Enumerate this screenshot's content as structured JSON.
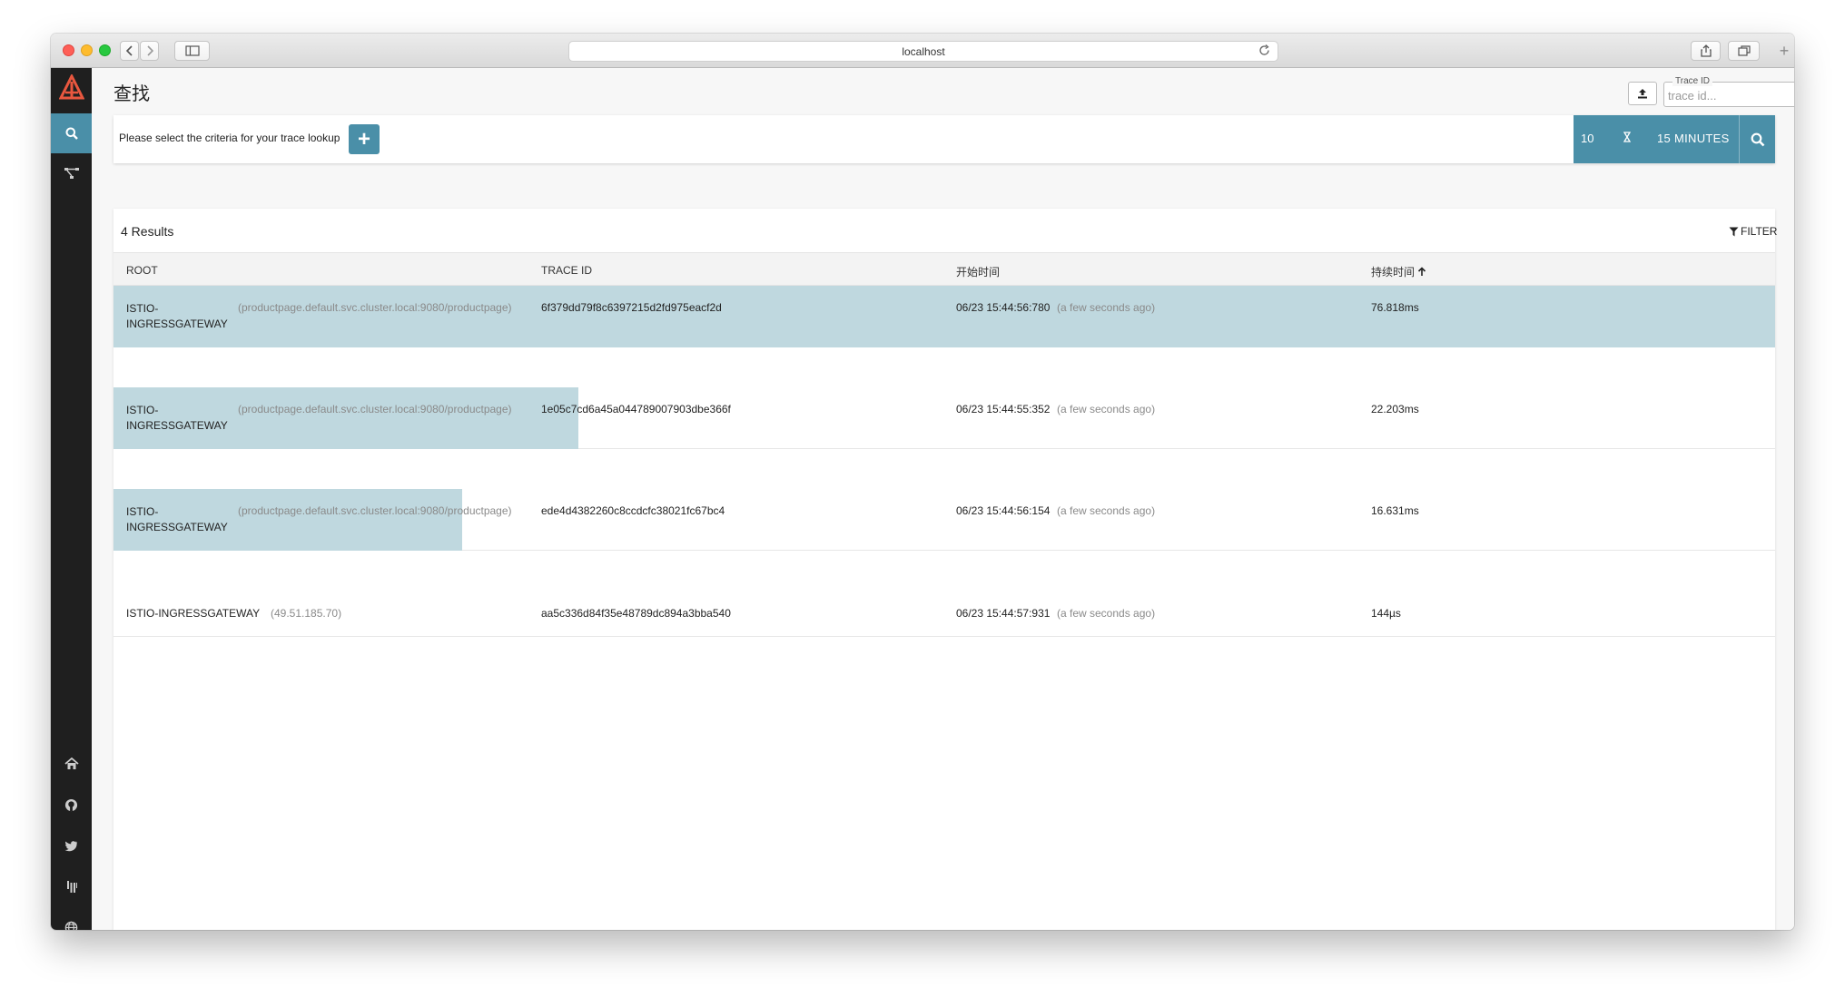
{
  "browser": {
    "url": "localhost"
  },
  "page": {
    "title": "查找"
  },
  "traceid": {
    "label": "Trace ID",
    "placeholder": "trace id..."
  },
  "criteria": {
    "prompt": "Please select the criteria for your trace lookup",
    "add": "+",
    "limit": "10",
    "lookback": "15 MINUTES"
  },
  "results": {
    "count": "4 Results",
    "filter": "FILTER",
    "columns": {
      "root": "ROOT",
      "trace_id": "TRACE ID",
      "start": "开始时间",
      "duration": "持续时间"
    },
    "rows": [
      {
        "root": "ISTIO-INGRESSGATEWAY",
        "detail": "(productpage.default.svc.cluster.local:9080/productpage)",
        "trace_id": "6f379dd79f8c6397215d2fd975eacf2d",
        "start": "06/23 15:44:56:780",
        "ago": "(a few seconds ago)",
        "duration": "76.818ms",
        "duration_fraction": 1.0
      },
      {
        "root": "ISTIO-INGRESSGATEWAY",
        "detail": "(productpage.default.svc.cluster.local:9080/productpage)",
        "trace_id": "1e05c7cd6a45a044789007903dbe366f",
        "start": "06/23 15:44:55:352",
        "ago": "(a few seconds ago)",
        "duration": "22.203ms",
        "duration_fraction": 0.28
      },
      {
        "root": "ISTIO-INGRESSGATEWAY",
        "detail": "(productpage.default.svc.cluster.local:9080/productpage)",
        "trace_id": "ede4d4382260c8ccdcfc38021fc67bc4",
        "start": "06/23 15:44:56:154",
        "ago": "(a few seconds ago)",
        "duration": "16.631ms",
        "duration_fraction": 0.21
      },
      {
        "root": "ISTIO-INGRESSGATEWAY",
        "detail": "(49.51.185.70)",
        "trace_id": "aa5c336d84f35e48789dc894a3bba540",
        "start": "06/23 15:44:57:931",
        "ago": "(a few seconds ago)",
        "duration": "144µs",
        "duration_fraction": 0.0
      }
    ]
  },
  "colors": {
    "accent": "#4a8fa8",
    "bar": "#bfd8df",
    "sidebar": "#1f1f1f",
    "logo": "#e9573f"
  },
  "icons": {
    "logo": "zipkin-logo-icon",
    "search": "search-icon",
    "dependencies": "dependencies-icon",
    "home": "home-icon",
    "github": "github-icon",
    "twitter": "twitter-icon",
    "gitter": "gitter-icon",
    "globe": "globe-icon"
  }
}
